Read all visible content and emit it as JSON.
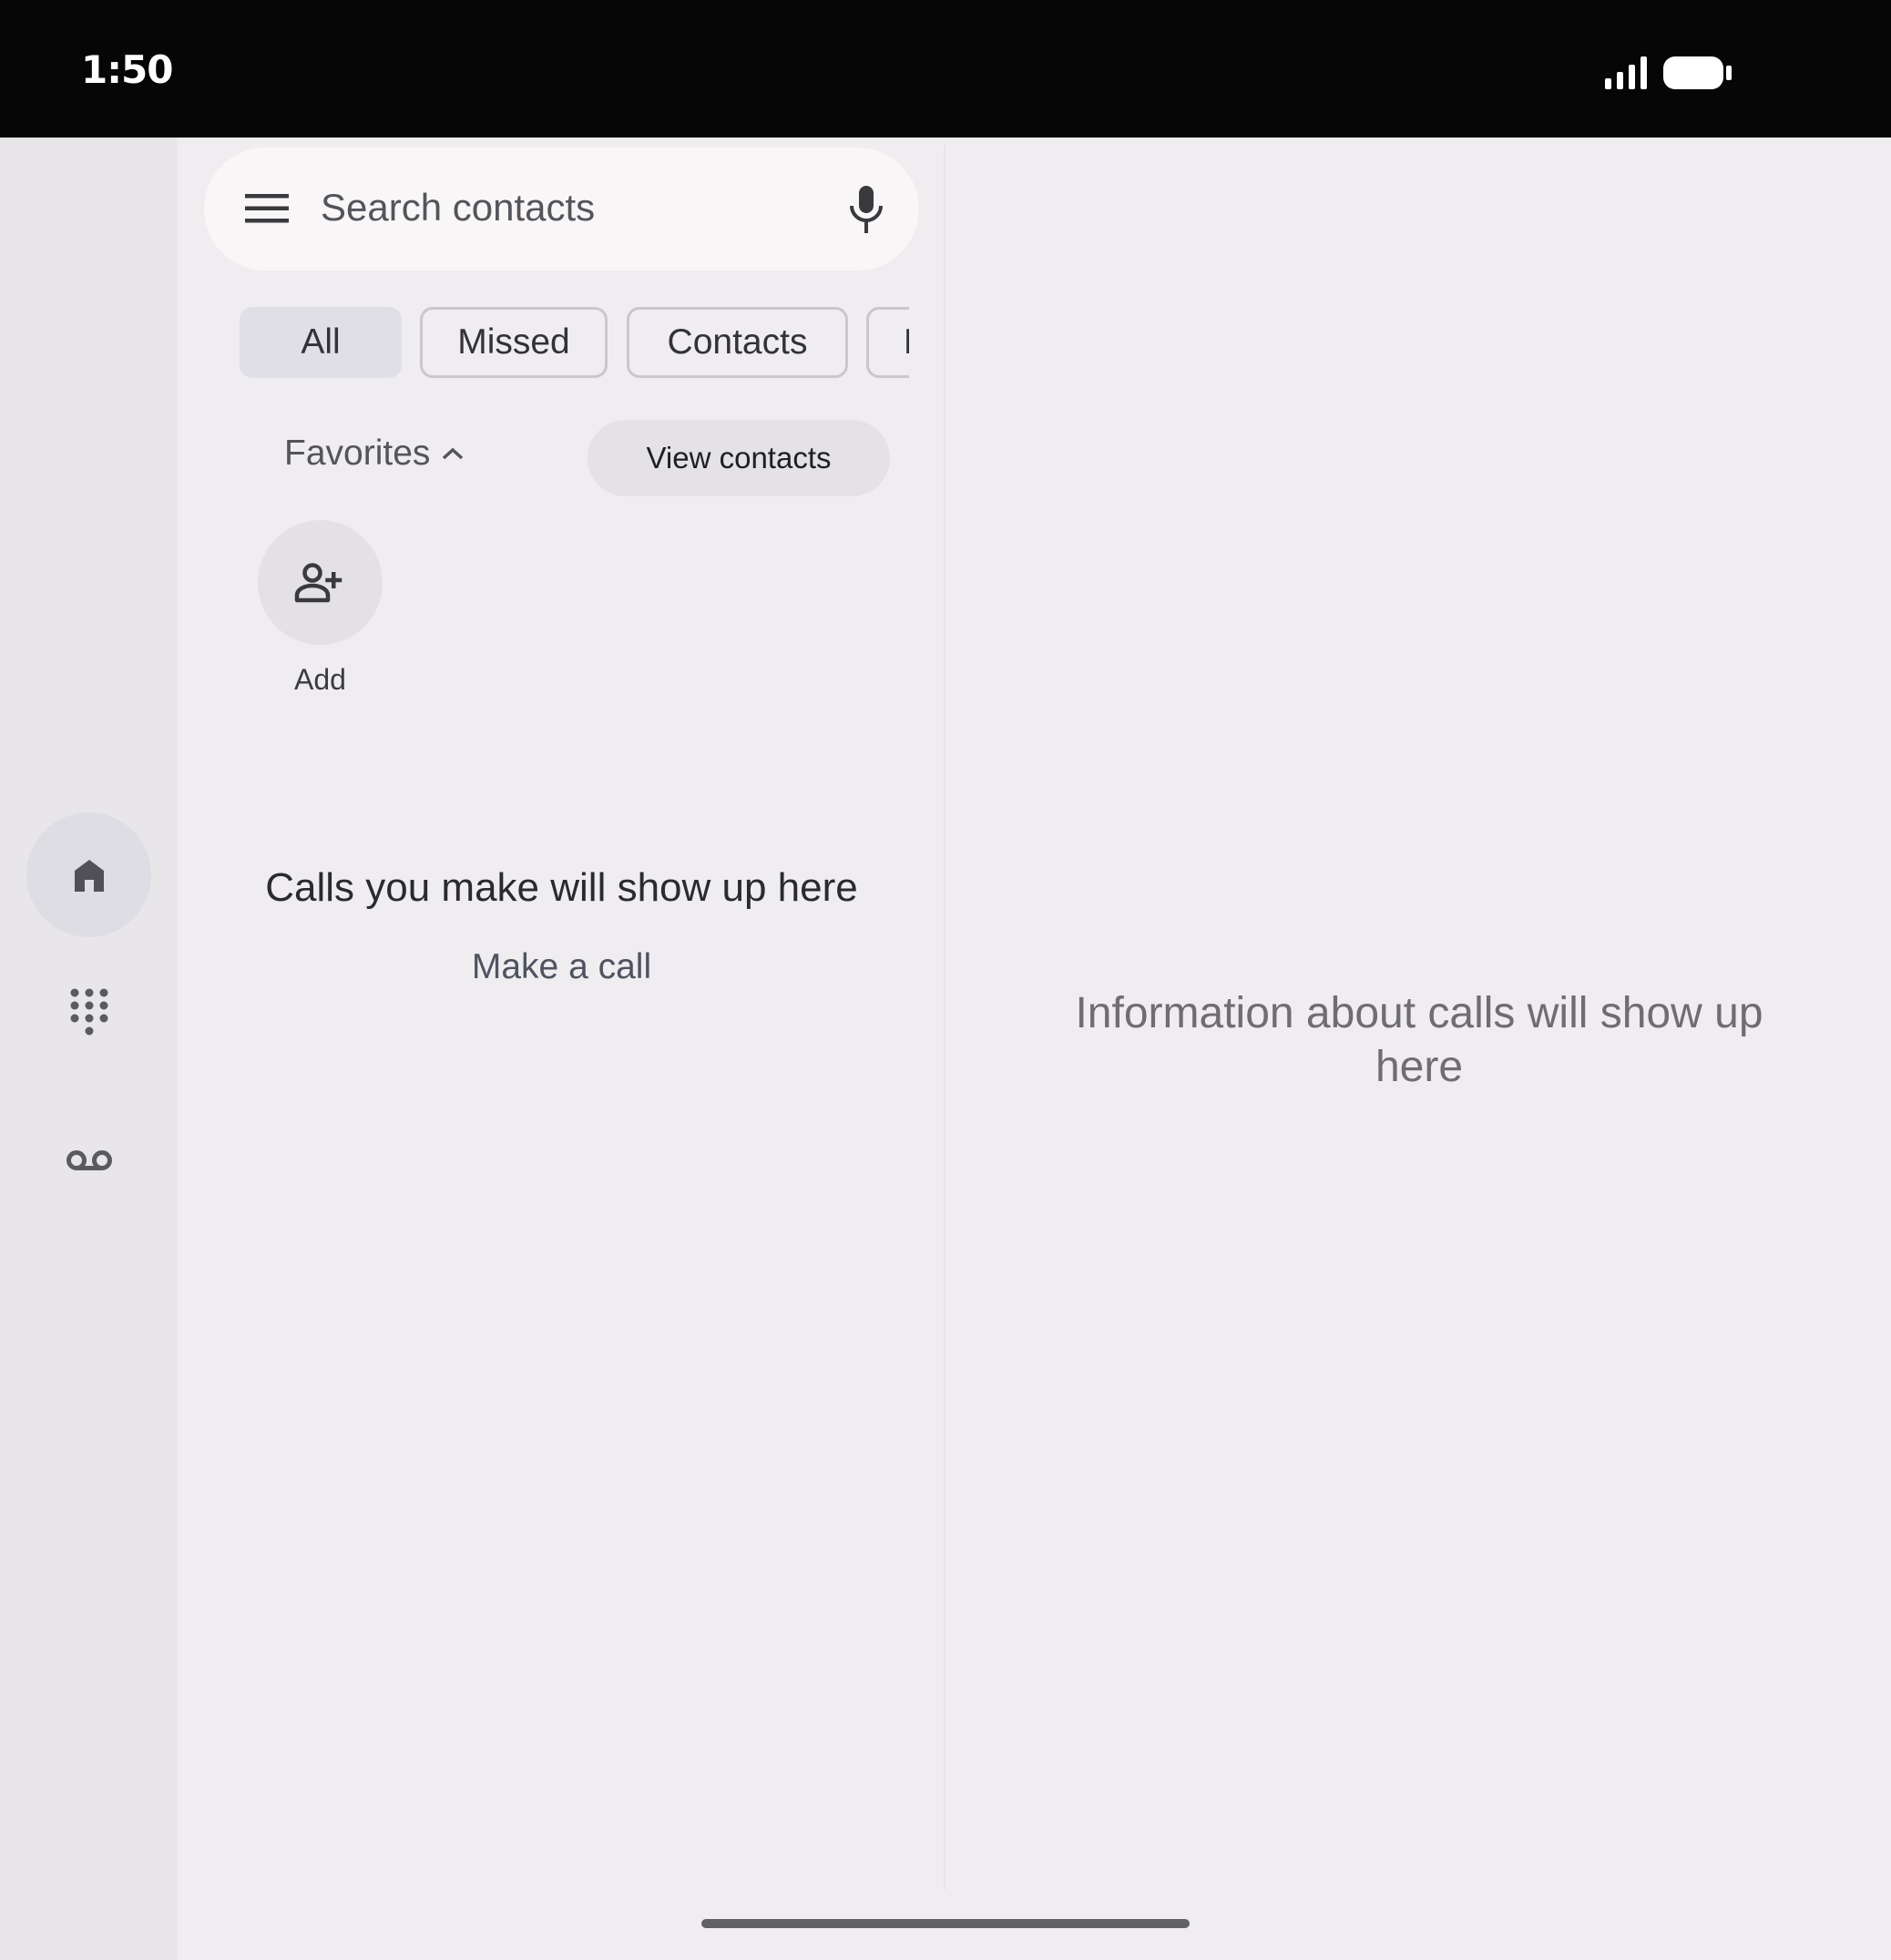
{
  "status_bar": {
    "time": "1:50"
  },
  "nav_rail": {
    "items": [
      {
        "icon": "home-icon",
        "label": "Home",
        "active": true
      },
      {
        "icon": "dialpad-icon",
        "label": "Keypad",
        "active": false
      },
      {
        "icon": "voicemail-icon",
        "label": "Voicemail",
        "active": false
      }
    ]
  },
  "search": {
    "placeholder": "Search contacts"
  },
  "filters": {
    "chips": [
      "All",
      "Missed",
      "Contacts",
      "Non-spam"
    ],
    "selected": "All"
  },
  "favorites": {
    "title": "Favorites",
    "view_contacts_label": "View contacts",
    "add_label": "Add"
  },
  "recents": {
    "empty_title": "Calls you make will show up here",
    "make_call_label": "Make a call"
  },
  "details": {
    "empty_text": "Information about calls will show up here"
  },
  "colors": {
    "background": "#efedef",
    "status_bar": "#060606",
    "nav_rail": "#e8e6e9",
    "selected_chip": "#e0dfe6"
  }
}
